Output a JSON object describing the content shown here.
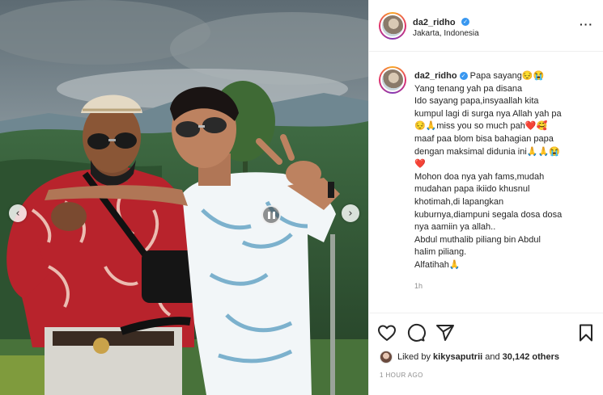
{
  "post": {
    "username": "da2_ridho",
    "location": "Jakarta, Indonesia",
    "more_icon": "more-options-icon",
    "verified_icon": "verified-badge-icon"
  },
  "caption": {
    "username": "da2_ridho",
    "lines": [
      "Papa sayang😔😭",
      "Yang tenang yah pa disana",
      "Ido sayang papa,insyaallah kita",
      "kumpul lagi di surga nya Allah yah pa",
      "😔🙏miss you so much pah❤️🥰",
      "maaf paa blom bisa bahagian papa",
      "dengan maksimal didunia ini🙏🙏😭",
      "❤️",
      "Mohon doa nya yah fams,mudah",
      "mudahan papa ikiido khusnul",
      "khotimah,di lapangkan",
      "kuburnya,diampuni segala dosa dosa",
      "nya aamiin ya allah..",
      "Abdul muthalib piliang bin Abdul",
      "halim piliang.",
      "Alfatihah🙏"
    ],
    "time": "1h"
  },
  "media": {
    "prev_label": "‹",
    "next_label": "›"
  },
  "engagement": {
    "liked_by_prefix": "Liked by ",
    "liked_by_user": "kikysaputrii",
    "liked_by_mid": " and ",
    "others": "30,142 others",
    "posted": "1 HOUR AGO"
  },
  "colors": {
    "accent": "#3897f0",
    "text": "#262626",
    "muted": "#8e8e8e",
    "border": "#efefef"
  }
}
